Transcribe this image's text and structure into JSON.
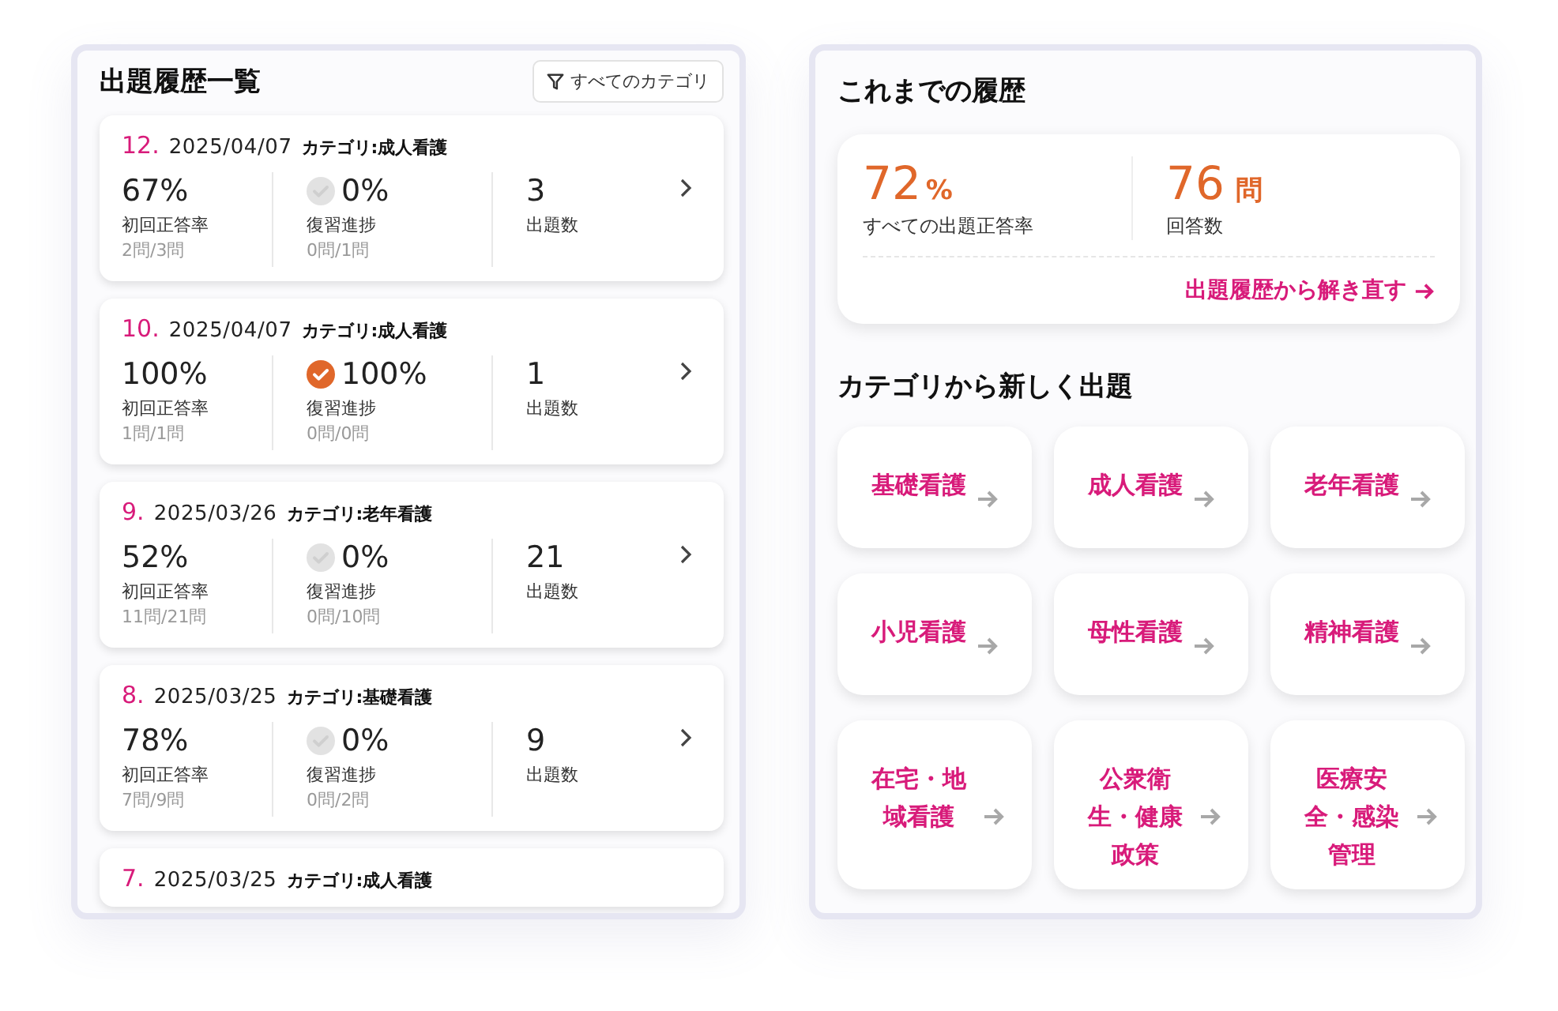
{
  "history": {
    "title": "出題履歴一覧",
    "filter_button": "すべてのカテゴリ",
    "records": [
      {
        "number": "12.",
        "date": "2025/04/07",
        "category": "カテゴリ:成人看護",
        "stats": {
          "first_rate": "67%",
          "first_label": "初回正答率",
          "first_count": "2問/3問",
          "review_done": false,
          "review_rate": "0%",
          "review_label": "復習進捗",
          "review_count": "0問/1問",
          "questions": "3",
          "questions_label": "出題数"
        }
      },
      {
        "number": "10.",
        "date": "2025/04/07",
        "category": "カテゴリ:成人看護",
        "stats": {
          "first_rate": "100%",
          "first_label": "初回正答率",
          "first_count": "1問/1問",
          "review_done": true,
          "review_rate": "100%",
          "review_label": "復習進捗",
          "review_count": "0問/0問",
          "questions": "1",
          "questions_label": "出題数"
        }
      },
      {
        "number": "9.",
        "date": "2025/03/26",
        "category": "カテゴリ:老年看護",
        "stats": {
          "first_rate": "52%",
          "first_label": "初回正答率",
          "first_count": "11問/21問",
          "review_done": false,
          "review_rate": "0%",
          "review_label": "復習進捗",
          "review_count": "0問/10問",
          "questions": "21",
          "questions_label": "出題数"
        }
      },
      {
        "number": "8.",
        "date": "2025/03/25",
        "category": "カテゴリ:基礎看護",
        "stats": {
          "first_rate": "78%",
          "first_label": "初回正答率",
          "first_count": "7問/9問",
          "review_done": false,
          "review_rate": "0%",
          "review_label": "復習進捗",
          "review_count": "0問/2問",
          "questions": "9",
          "questions_label": "出題数"
        }
      },
      {
        "number": "7.",
        "date": "2025/03/25",
        "category": "カテゴリ:成人看護"
      }
    ]
  },
  "summary": {
    "title": "これまでの履歴",
    "rate_value": "72",
    "rate_unit": "%",
    "rate_label": "すべての出題正答率",
    "count_value": "76",
    "count_unit": "問",
    "count_label": "回答数",
    "link": "出題履歴から解き直す"
  },
  "categories": {
    "title": "カテゴリから新しく出題",
    "items": [
      "基礎看護",
      "成人看護",
      "老年看護",
      "小児看護",
      "母性看護",
      "精神看護",
      "在宅・地域看護",
      "公衆衛生・健康政策",
      "医療安全・感染管理"
    ]
  }
}
